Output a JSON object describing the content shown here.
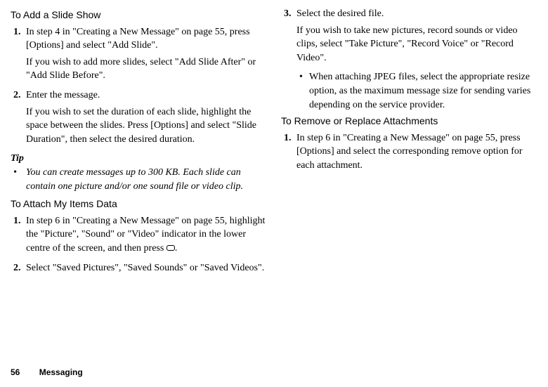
{
  "left": {
    "heading1": "To Add a Slide Show",
    "s1": {
      "n1": "1.",
      "p1a": "In step 4 in \"Creating a New Message\" on page 55, press [Options] and select \"Add Slide\".",
      "p1b": "If you wish to add more slides, select \"Add Slide After\" or \"Add Slide Before\".",
      "n2": "2.",
      "p2a": "Enter the message.",
      "p2b": "If you wish to set the duration of each slide, highlight the space between the slides. Press [Options] and select \"Slide Duration\", then select the desired duration."
    },
    "tipLabel": "Tip",
    "tipBullet": "•",
    "tipText": "You can create messages up to 300 KB. Each slide can contain one picture and/or one sound file or video clip.",
    "heading2": "To Attach My Items Data",
    "s2": {
      "n1": "1.",
      "p1a_pre": "In step 6 in \"Creating a New Message\" on page 55, highlight the \"Picture\", \"Sound\" or \"Video\" indicator in the lower centre of the screen, and then press ",
      "p1a_post": ".",
      "n2": "2.",
      "p2a": "Select \"Saved Pictures\", \"Saved Sounds\" or \"Saved Videos\"."
    }
  },
  "right": {
    "s3": {
      "n3": "3.",
      "p3a": "Select the desired file.",
      "p3b": "If you wish to take new pictures, record sounds or video clips, select \"Take Picture\", \"Record Voice\" or \"Record Video\".",
      "bullet": "•",
      "bulletText": "When attaching JPEG files, select the appropriate resize option, as the maximum message size for sending varies depending on the service provider."
    },
    "heading3": "To Remove or Replace Attachments",
    "s4": {
      "n1": "1.",
      "p1a": "In step 6 in \"Creating a New Message\" on page 55, press [Options] and select the corresponding remove option for each attachment."
    }
  },
  "footer": {
    "page": "56",
    "chapter": "Messaging"
  }
}
